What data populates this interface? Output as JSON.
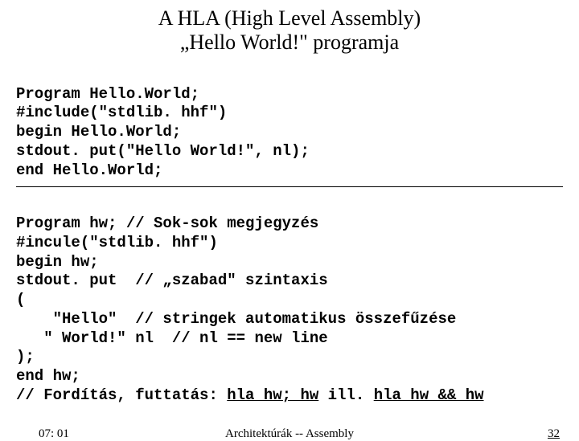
{
  "title_line1": "A HLA (High Level Assembly)",
  "title_line2": "„Hello World!\" programja",
  "code1": {
    "l1": "Program Hello.World;",
    "l2": "#include(\"stdlib. hhf\")",
    "l3": "begin Hello.World;",
    "l4": "stdout. put(\"Hello World!\", nl);",
    "l5": "end Hello.World;"
  },
  "code2": {
    "l1": "Program hw; // Sok-sok megjegyzés",
    "l2": "#incule(\"stdlib. hhf\")",
    "l3": "begin hw;",
    "l4": "stdout. put  // „szabad\" szintaxis",
    "l5": "(",
    "l6": "    \"Hello\"  // stringek automatikus összefűzése",
    "l7": "   \" World!\" nl  // nl == new line",
    "l8": ");",
    "l9": "end hw;",
    "l10a": "// Fordítás, futtatás: ",
    "l10b": "hla hw; hw",
    "l10c": " ill. ",
    "l10d": "hla hw && hw"
  },
  "footer": {
    "time": "07: 01",
    "center": "Architektúrák -- Assembly",
    "page": "32"
  }
}
